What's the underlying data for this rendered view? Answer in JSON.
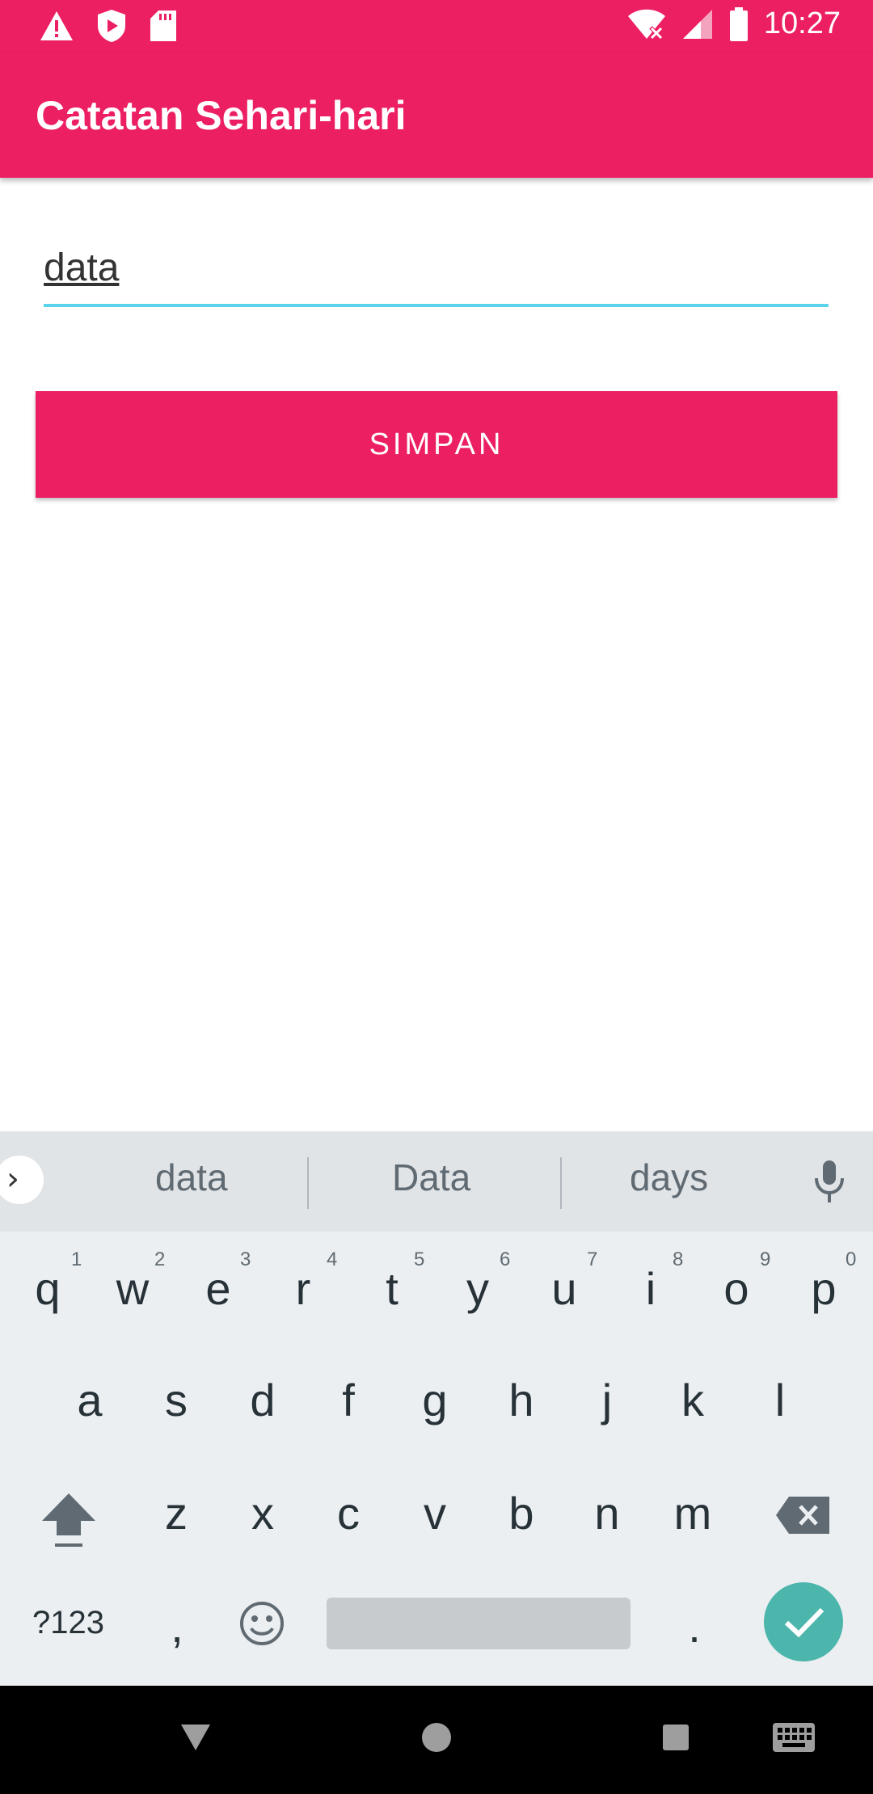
{
  "status_bar": {
    "time": "10:27",
    "icons": [
      "warning-icon",
      "shield-play-icon",
      "sd-card-icon",
      "wifi-x-icon",
      "signal-icon",
      "battery-icon"
    ]
  },
  "app_bar": {
    "title": "Catatan Sehari-hari"
  },
  "form": {
    "input_value": "data",
    "save_label": "SIMPAN"
  },
  "keyboard": {
    "suggestions": [
      "data",
      "Data",
      "days"
    ],
    "row1": [
      "q",
      "w",
      "e",
      "r",
      "t",
      "y",
      "u",
      "i",
      "o",
      "p"
    ],
    "row1_hints": [
      "1",
      "2",
      "3",
      "4",
      "5",
      "6",
      "7",
      "8",
      "9",
      "0"
    ],
    "row2": [
      "a",
      "s",
      "d",
      "f",
      "g",
      "h",
      "j",
      "k",
      "l"
    ],
    "row3": [
      "z",
      "x",
      "c",
      "v",
      "b",
      "n",
      "m"
    ],
    "symbols_label": "?123",
    "comma": ",",
    "period": "."
  },
  "colors": {
    "accent": "#EC1F63",
    "input_underline": "#59D4EC",
    "enter": "#4DB6AC"
  }
}
